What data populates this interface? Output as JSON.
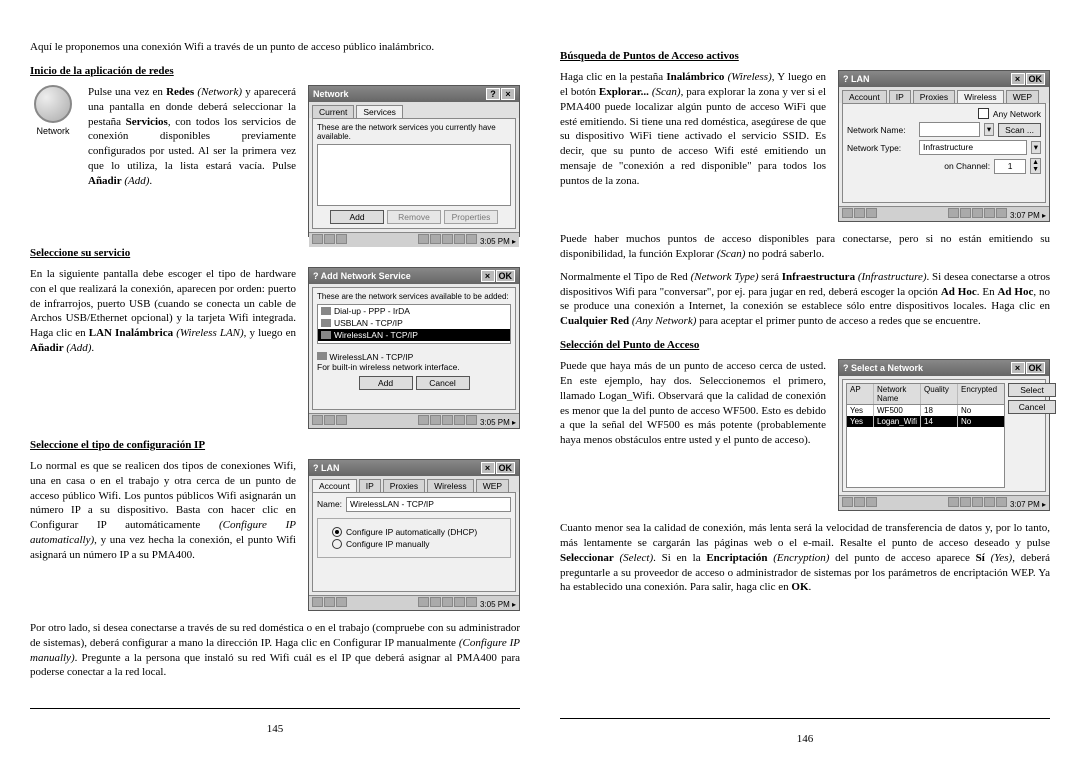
{
  "page_left": {
    "intro": "Aquí le proponemos una conexión Wifi a través de un punto de acceso público inalámbrico.",
    "h1": "Inicio de la aplicación de redes",
    "network_icon_label": "Network",
    "p1_html": "Pulse una vez en <b>Redes</b> <i>(Network)</i> y aparecerá una pantalla en donde deberá seleccionar la pestaña <b>Servicios</b>, con todos los servicios de conexión disponibles previamente configurados por usted. Al ser la primera vez que lo utiliza, la lista estará vacía. Pulse <b>Añadir</b> <i>(Add)</i>.",
    "h2": "Seleccione su servicio",
    "p2_html": "En la siguiente pantalla debe escoger el tipo de hardware con el que realizará la conexión, aparecen por orden: puerto de infrarrojos, puerto USB (cuando se conecta un cable de Archos USB/Ethernet opcional) y la tarjeta Wifi integrada. Haga clic en <b>LAN Inalámbrica</b> <i>(Wireless LAN)</i>, y luego en <b>Añadir</b> <i>(Add)</i>.",
    "h3": "Seleccione el tipo de configuración IP",
    "p3_html": "Lo normal es que se realicen dos tipos de conexiones Wifi, una en casa o en el trabajo y otra cerca de un punto de acceso público Wifi. Los puntos públicos Wifi asignarán un número IP a su dispositivo. Basta con hacer clic en Configurar IP automáticamente <i>(Configure IP automatically)</i>, y una vez hecha la conexión, el punto Wifi asignará un número IP a su PMA400.",
    "p4_html": "Por otro lado, si desea conectarse a través de su red doméstica o en el trabajo (compruebe con su administrador de sistemas), deberá configurar a mano la dirección IP. Haga clic en Configurar IP manualmente <i>(Configure IP manually)</i>. Pregunte a la persona que instaló su red Wifi cuál es el IP que deberá asignar al PMA400 para poderse conectar a la red local.",
    "screenshots": {
      "s1": {
        "title": "Network",
        "tab1": "Current",
        "tab2": "Services",
        "hint": "These are the network services you currently have available.",
        "btn_add": "Add",
        "btn_remove": "Remove",
        "btn_props": "Properties",
        "time": "3:05 PM"
      },
      "s2": {
        "title": "Add Network Service",
        "hint": "These are the network services available to be added:",
        "item1": "Dial-up - PPP - IrDA",
        "item2": "USBLAN - TCP/IP",
        "item3": "WirelessLAN - TCP/IP",
        "desc1": "WirelessLAN - TCP/IP",
        "desc2": "For built-in wireless network interface.",
        "btn_add": "Add",
        "btn_cancel": "Cancel",
        "time": "3:05 PM"
      },
      "s3": {
        "title": "LAN",
        "tab_account": "Account",
        "tab_ip": "IP",
        "tab_proxies": "Proxies",
        "tab_wireless": "Wireless",
        "tab_wep": "WEP",
        "name_label": "Name:",
        "name_value": "WirelessLAN - TCP/IP",
        "radio1": "Configure IP automatically (DHCP)",
        "radio2": "Configure IP manually",
        "time": "3:05 PM"
      }
    },
    "number": "145"
  },
  "page_right": {
    "h1": "Búsqueda de Puntos de Acceso activos",
    "p1_html": "Haga clic en la pestaña <b>Inalámbrico</b> <i>(Wireless)</i>, Y luego en el botón <b>Explorar...</b> <i>(Scan)</i>, para explorar la zona y ver si el PMA400 puede localizar algún punto de acceso WiFi que esté emitiendo. Si tiene una red doméstica, asegúrese de que su dispositivo WiFi tiene activado el servicio SSID. Es decir, que su punto de acceso Wifi esté emitiendo un mensaje de \"conexión a red disponible\" para todos los puntos de la zona.",
    "p2_html": "Puede haber muchos puntos de acceso disponibles para conectarse, pero si no están emitiendo su disponibilidad, la función Explorar <i>(Scan)</i> no podrá saberlo.",
    "p3_html": "Normalmente el Tipo de Red <i>(Network Type)</i> será <b>Infraestructura</b> <i>(Infrastructure)</i>. Si desea conectarse a otros dispositivos Wifi para \"conversar\", por ej. para jugar en red, deberá escoger la opción <b>Ad Hoc</b>. En <b>Ad Hoc</b>, no se produce una conexión a Internet, la conexión se establece sólo entre dispositivos locales. Haga clic en <b>Cualquier Red</b> <i>(Any Network)</i> para aceptar el primer punto de acceso a redes que se encuentre.",
    "h2": "Selección del Punto de Acceso",
    "p4_html": "Puede que haya más de un punto de acceso cerca de usted. En este ejemplo, hay dos. Seleccionemos el primero, llamado Logan_Wifi. Observará que la calidad de conexión es menor que la del punto de acceso WF500. Esto es debido a que la señal del WF500 es más potente (probablemente haya menos obstáculos entre usted y el punto de acceso).",
    "p5_html": "Cuanto menor sea la calidad de conexión, más lenta será la velocidad de transferencia de datos y, por lo tanto, más lentamente se cargarán las páginas web o el e-mail. Resalte el punto de acceso deseado y pulse <b>Seleccionar</b> <i>(Select)</i>. Si en la <b>Encriptación</b> <i>(Encryption)</i> del punto de acceso aparece <b>Sí</b> <i>(Yes)</i>, deberá preguntarle a su proveedor de acceso o administrador de sistemas por los parámetros de encriptación WEP. Ya ha establecido una conexión. Para salir, haga clic en <b>OK</b>.",
    "screenshots": {
      "s1": {
        "title": "LAN",
        "tab_account": "Account",
        "tab_ip": "IP",
        "tab_proxies": "Proxies",
        "tab_wireless": "Wireless",
        "tab_wep": "WEP",
        "any_network": "Any Network",
        "netname_label": "Network Name:",
        "scan_btn": "Scan ...",
        "nettype_label": "Network Type:",
        "nettype_value": "Infrastructure",
        "channel_label": "on Channel:",
        "channel_value": "1",
        "time": "3:07 PM"
      },
      "s2": {
        "title": "Select a Network",
        "col_ap": "AP",
        "col_name": "Network Name",
        "col_quality": "Quality",
        "col_enc": "Encrypted",
        "row1": {
          "ap": "Yes",
          "name": "WF500",
          "q": "18",
          "enc": "No"
        },
        "row2": {
          "ap": "Yes",
          "name": "Logan_Wifi",
          "q": "14",
          "enc": "No"
        },
        "btn_select": "Select",
        "btn_cancel": "Cancel",
        "time": "3:07 PM"
      }
    },
    "number": "146"
  }
}
